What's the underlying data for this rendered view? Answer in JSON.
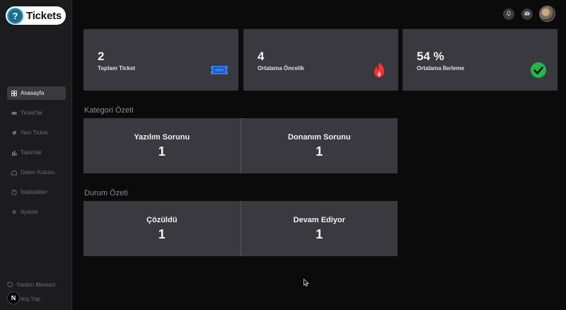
{
  "app": {
    "logo_glyph": "?",
    "logo_text": "Tickets"
  },
  "sidebar": {
    "items": [
      {
        "label": "Anasayfa",
        "icon": "grid-icon",
        "active": true
      },
      {
        "label": "Ticket'lar",
        "icon": "ticket-icon",
        "active": false
      },
      {
        "label": "Yeni Ticket",
        "icon": "tag-icon",
        "active": false
      },
      {
        "label": "Takımlar",
        "icon": "team-icon",
        "active": false
      },
      {
        "label": "Gelen Kutusu",
        "icon": "inbox-icon",
        "active": false
      },
      {
        "label": "İstatistikler",
        "icon": "chart-icon",
        "active": false
      },
      {
        "label": "Ayarlar",
        "icon": "gear-icon",
        "active": false
      }
    ],
    "help_label": "Yardım Merkezi",
    "logout_label": "Çıkış Yap",
    "dev_badge": "N"
  },
  "stats": [
    {
      "value": "2",
      "label": "Toplam Ticket",
      "icon": "ticket-icon",
      "icon_color": "#2f7df6"
    },
    {
      "value": "4",
      "label": "Ortalama Öncelik",
      "icon": "fire-icon",
      "icon_color": "#ff2d2d"
    },
    {
      "value": "54 %",
      "label": "Ortalama İlerleme",
      "icon": "check-circle-icon",
      "icon_color": "#1fb84a"
    }
  ],
  "category_summary": {
    "title": "Kategori Özeti",
    "items": [
      {
        "name": "Yazılım Sorunu",
        "count": "1"
      },
      {
        "name": "Donanım Sorunu",
        "count": "1"
      }
    ]
  },
  "status_summary": {
    "title": "Durum Özeti",
    "items": [
      {
        "name": "Çözüldü",
        "count": "1"
      },
      {
        "name": "Devam Ediyor",
        "count": "1"
      }
    ]
  },
  "colors": {
    "background": "#0b0b0c",
    "sidebar": "#1c1c1f",
    "card": "#39393f"
  }
}
